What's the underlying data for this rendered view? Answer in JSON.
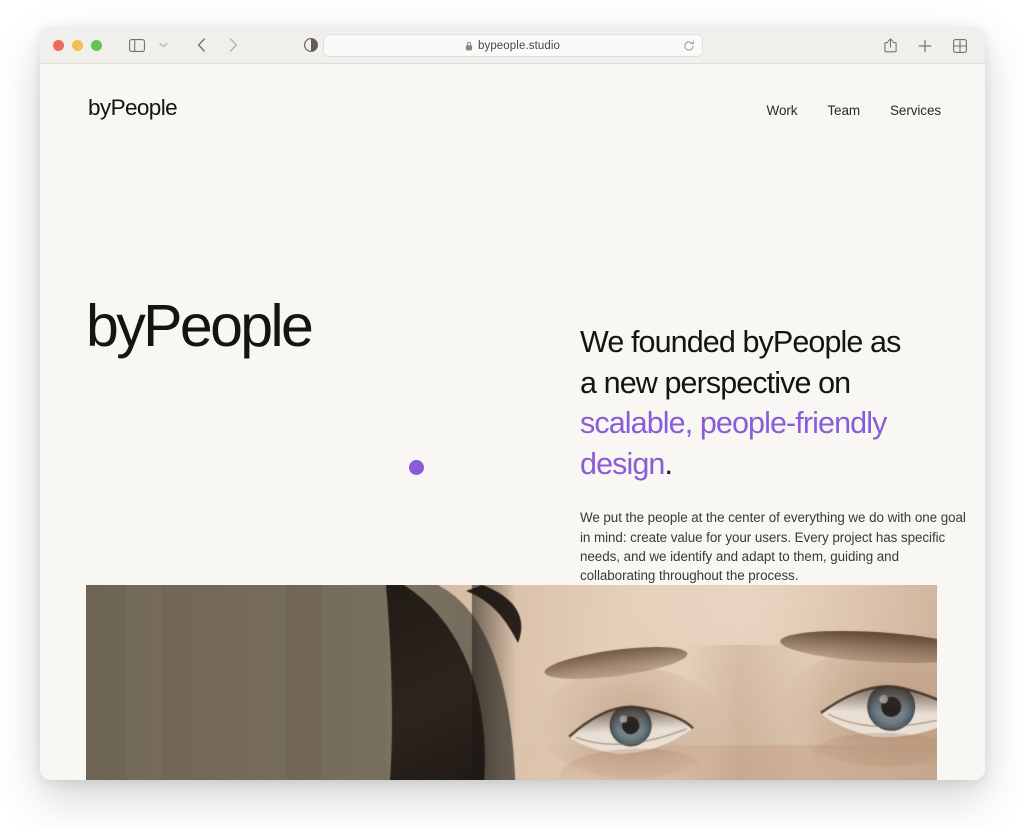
{
  "browser": {
    "traffic_lights": [
      {
        "name": "close",
        "color": "#ed6a5e"
      },
      {
        "name": "minimize",
        "color": "#f4bf4f"
      },
      {
        "name": "maximize",
        "color": "#61c454"
      }
    ],
    "url": "bypeople.studio",
    "url_placeholder": "Search or enter website name",
    "icons": {
      "sidebar": "sidebar-toggle-icon",
      "sidebar_chevron": "chevron-down-icon",
      "back": "back-arrow-icon",
      "forward": "forward-arrow-icon",
      "reader": "reader-contrast-icon",
      "lock": "lock-icon",
      "reload": "reload-icon",
      "share": "share-icon",
      "new_tab": "plus-icon",
      "tab_overview": "tab-overview-icon"
    }
  },
  "site": {
    "brand": "byPeople",
    "nav": [
      {
        "label": "Work"
      },
      {
        "label": "Team"
      },
      {
        "label": "Services"
      }
    ],
    "hero": {
      "title": "byPeople",
      "headline_line1": "We founded byPeople as",
      "headline_line2": "a new perspective on",
      "headline_accent": "scalable, people-friendly design",
      "headline_period": ".",
      "paragraph": "We put the people at the center of everything we do with one goal in mind: create value for your users. Every project has specific needs, and we identify and adapt to them, guiding and collaborating throughout the process.",
      "photo_alt": "Close-up portrait of a person wearing a dark beanie looking upward"
    }
  },
  "colors": {
    "page_background": "#f9f7f3",
    "text": "#16140f",
    "accent_purple": "#8b5cd8",
    "toolbar": "#f1efec"
  }
}
